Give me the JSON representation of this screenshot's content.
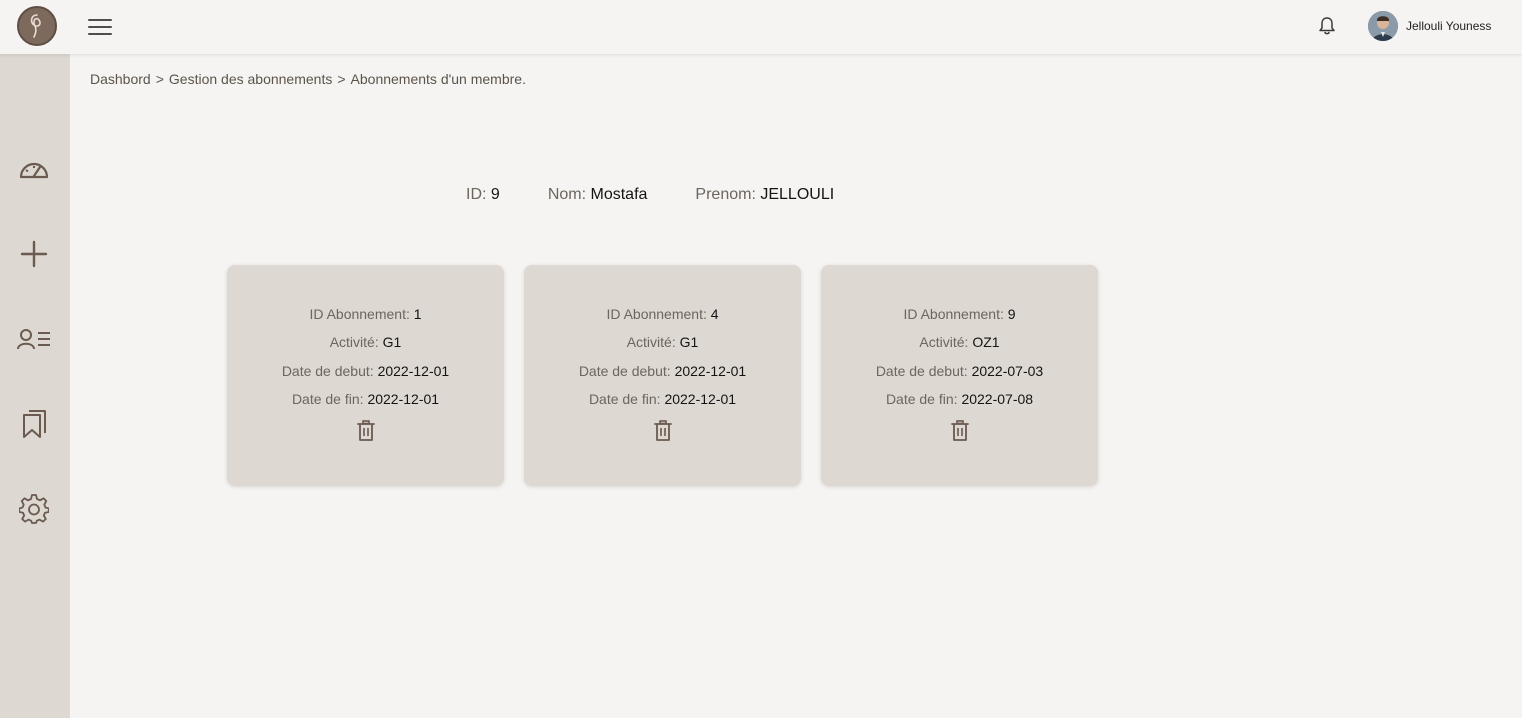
{
  "header": {
    "user_name": "Jellouli Youness"
  },
  "breadcrumb": [
    "Dashbord",
    "Gestion des abonnements",
    "Abonnements d'un membre."
  ],
  "breadcrumb_separator": ">",
  "member": {
    "id_label": "ID:",
    "id_value": "9",
    "nom_label": "Nom:",
    "nom_value": "Mostafa",
    "prenom_label": "Prenom:",
    "prenom_value": "JELLOULI"
  },
  "labels": {
    "id_abonnement": "ID Abonnement:",
    "activite": "Activité:",
    "date_debut": "Date de debut:",
    "date_fin": "Date de fin:"
  },
  "subscriptions": [
    {
      "id": "1",
      "activite": "G1",
      "date_debut": "2022-12-01",
      "date_fin": "2022-12-01"
    },
    {
      "id": "4",
      "activite": "G1",
      "date_debut": "2022-12-01",
      "date_fin": "2022-12-01"
    },
    {
      "id": "9",
      "activite": "OZ1",
      "date_debut": "2022-07-03",
      "date_fin": "2022-07-08"
    }
  ],
  "icons": {
    "logo": "logo-icon",
    "menu": "hamburger-menu-icon",
    "notifications": "bell-icon",
    "sidebar": [
      "dashboard-gauge-icon",
      "plus-icon",
      "members-list-icon",
      "bookmarks-icon",
      "gear-icon"
    ],
    "delete": "trash-icon"
  },
  "colors": {
    "background": "#f5f4f2",
    "sidebar": "#ddd8d1",
    "card": "#ddd8d1",
    "logo": "#7d6a5d",
    "icon": "#6b5a50"
  }
}
